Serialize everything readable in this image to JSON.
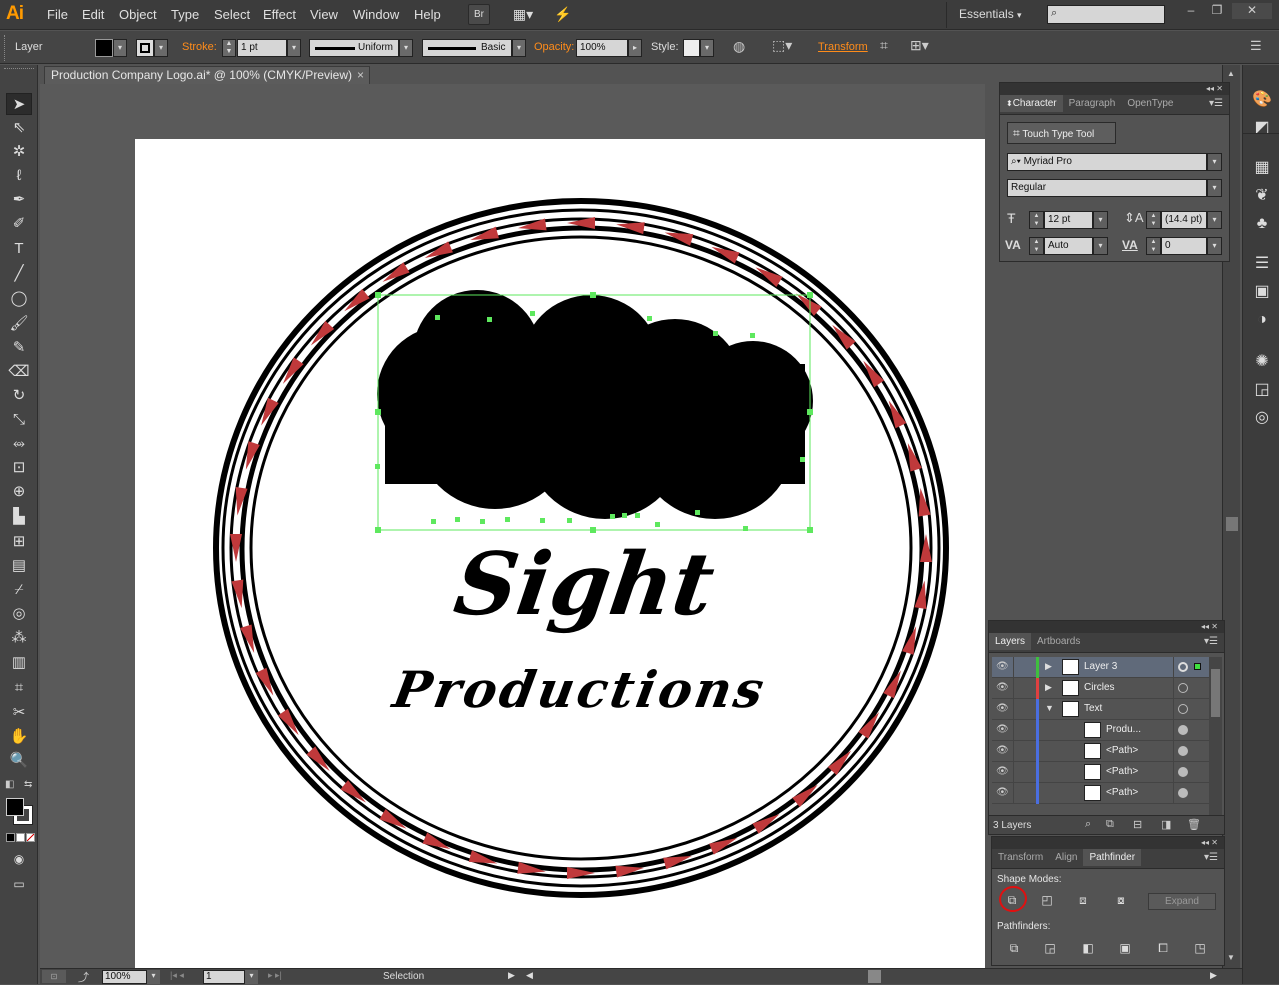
{
  "app": {
    "logo": "Ai"
  },
  "menu": [
    "File",
    "Edit",
    "Object",
    "Type",
    "Select",
    "Effect",
    "View",
    "Window",
    "Help"
  ],
  "menubar_buttons": {
    "bridge": "Br"
  },
  "workspace": {
    "label": "Essentials",
    "arrow": "▾"
  },
  "control_bar": {
    "selection_label": "Layer",
    "stroke_label": "Stroke:",
    "stroke_weight": "1 pt",
    "profile": "Uniform",
    "brush": "Basic",
    "opacity_label": "Opacity:",
    "opacity_value": "100%",
    "style_label": "Style:",
    "transform_label": "Transform"
  },
  "document": {
    "tab_title": "Production Company Logo.ai* @ 100% (CMYK/Preview)",
    "close": "×"
  },
  "artwork": {
    "title_word": "Sight",
    "subtitle_word": "Productions"
  },
  "character_panel": {
    "tabs": [
      "Character",
      "Paragraph",
      "OpenType"
    ],
    "touch_type_label": "Touch Type Tool",
    "font_family": "Myriad Pro",
    "font_style": "Regular",
    "font_size": "12 pt",
    "leading": "(14.4 pt)",
    "kerning": "Auto",
    "tracking": "0"
  },
  "layers_panel": {
    "tabs": [
      "Layers",
      "Artboards"
    ],
    "rows": [
      {
        "name": "Layer 3",
        "color": "#3fbf3f",
        "expand": "▶"
      },
      {
        "name": "Circles",
        "color": "#e04040",
        "expand": "▶"
      },
      {
        "name": "Text",
        "color": "#4a6ee0",
        "expand": "▼"
      },
      {
        "name": "Produ...",
        "color": "#4a6ee0",
        "expand": ""
      },
      {
        "name": "<Path>",
        "color": "#4a6ee0",
        "expand": ""
      },
      {
        "name": "<Path>",
        "color": "#4a6ee0",
        "expand": ""
      },
      {
        "name": "<Path>",
        "color": "#4a6ee0",
        "expand": ""
      }
    ],
    "count": "3 Layers"
  },
  "pathfinder_panel": {
    "tabs": [
      "Transform",
      "Align",
      "Pathfinder"
    ],
    "shape_modes_label": "Shape Modes:",
    "expand_label": "Expand",
    "pathfinders_label": "Pathfinders:"
  },
  "status_bar": {
    "zoom": "100%",
    "artboard": "1",
    "tool": "Selection"
  },
  "colors": {
    "selection_outline": "#5ee85e",
    "arrow_fill": "#c0393b",
    "accent": "#ff8c1a",
    "highlight_ring": "#e01010"
  }
}
